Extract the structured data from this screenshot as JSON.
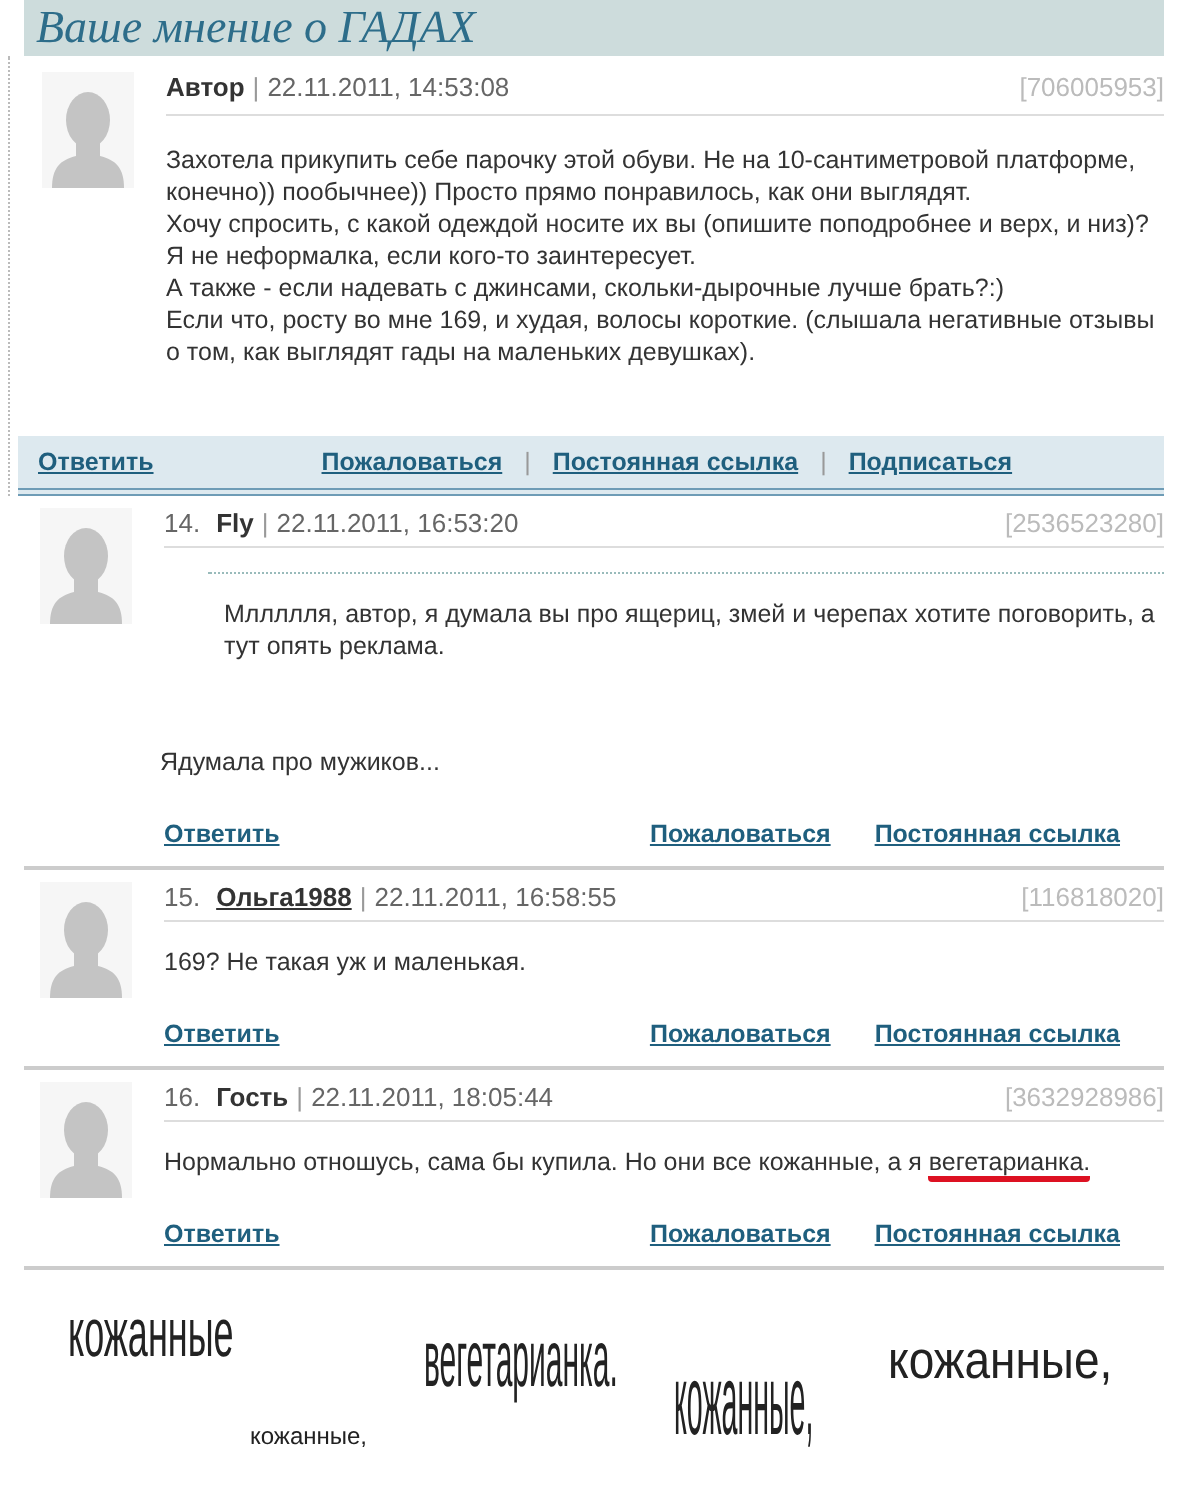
{
  "page_title": "Ваше мнение о ГАДАХ",
  "post": {
    "author": "Автор",
    "separator": "|",
    "date": "22.11.2011, 14:53:08",
    "id": "[706005953]",
    "paragraphs": [
      "Захотела прикупить себе парочку этой обуви. Не на 10-сантиметровой платформе, конечно)) пообычнее)) Просто прямо понравилось, как они выглядят.",
      "Хочу спросить, с какой одеждой носите их вы (опишите поподробнее и верх, и низ)? Я не неформалка, если кого-то заинтересует.",
      "А также - если надевать с джинсами, скольки-дырочные лучше брать?:)",
      "Если что, росту во мне 169, и худая, волосы короткие. (слышала негативные отзывы о том, как выглядят гады на маленьких девушках)."
    ],
    "actions": [
      {
        "kind": "link",
        "label": "Ответить"
      },
      {
        "kind": "link",
        "label": "Пожаловаться"
      },
      {
        "kind": "separator",
        "label": "|"
      },
      {
        "kind": "link",
        "label": "Постоянная ссылка"
      },
      {
        "kind": "separator",
        "label": "|"
      },
      {
        "kind": "link",
        "label": "Подписаться"
      }
    ]
  },
  "comments": [
    {
      "number": "14.",
      "author": "Fly",
      "author_is_link": false,
      "separator": "|",
      "date": "22.11.2011, 16:53:20",
      "id": "[2536523280]",
      "quote": "Мллллля, автор, я думала вы про ящериц, змей и черепах хотите поговорить, а тут опять реклама.",
      "text": "Ядумала про мужиков...",
      "actions": [
        {
          "label": "Ответить"
        },
        {
          "label": "Пожаловаться"
        },
        {
          "label": "Постоянная ссылка"
        }
      ]
    },
    {
      "number": "15.",
      "author": "Ольга1988",
      "author_is_link": true,
      "separator": "|",
      "date": "22.11.2011, 16:58:55",
      "id": "[116818020]",
      "text": "169? Не такая уж и маленькая.",
      "actions": [
        {
          "label": "Ответить"
        },
        {
          "label": "Пожаловаться"
        },
        {
          "label": "Постоянная ссылка"
        }
      ]
    },
    {
      "number": "16.",
      "author": "Гость",
      "author_is_link": false,
      "separator": "|",
      "date": "22.11.2011, 18:05:44",
      "id": "[3632928986]",
      "text": "Нормально отношусь, сама бы купила. Но они все кожанные, а я ",
      "highlighted": "вегетарианка.",
      "actions": [
        {
          "label": "Ответить"
        },
        {
          "label": "Пожаловаться"
        },
        {
          "label": "Постоянная ссылка"
        }
      ]
    }
  ],
  "collage": [
    {
      "text": "кожанные"
    },
    {
      "text": "кожанные,"
    },
    {
      "text": "вегетарианка."
    },
    {
      "text": "кожанные,"
    },
    {
      "text": "кожанные,"
    }
  ]
}
